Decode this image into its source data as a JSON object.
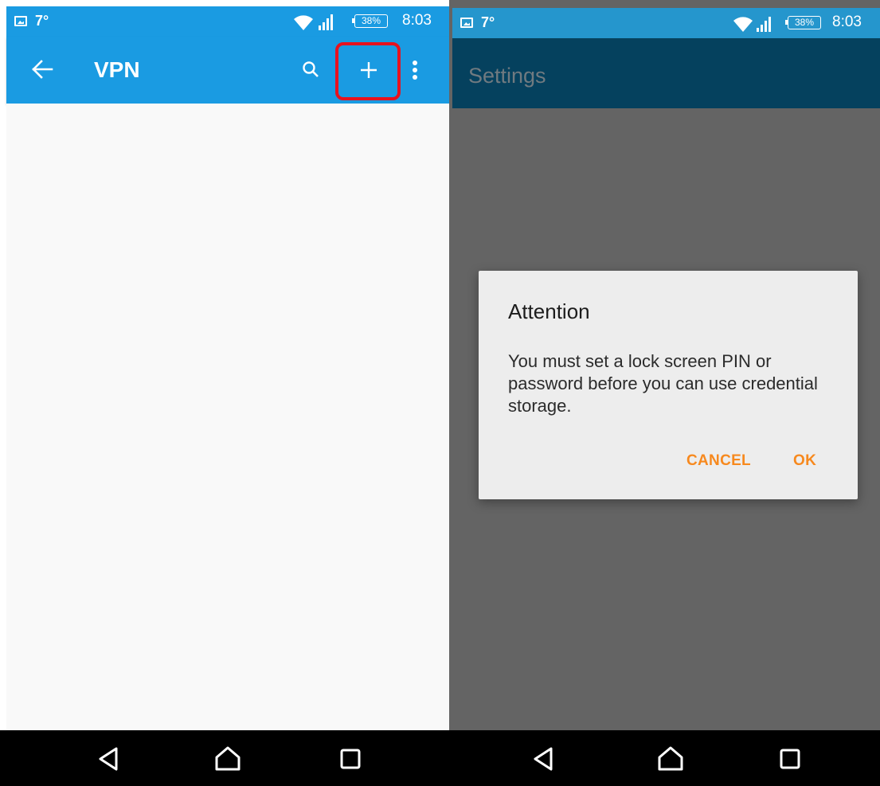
{
  "left": {
    "status": {
      "temperature": "7°",
      "battery": "38%",
      "time": "8:03"
    },
    "appbar": {
      "title": "VPN",
      "icons": [
        "back-arrow-icon",
        "search-icon",
        "plus-icon",
        "overflow-menu-icon"
      ]
    },
    "highlight_color": "#e8121e",
    "colors": {
      "appbar": "#1a9be2"
    }
  },
  "right": {
    "status": {
      "temperature": "7°",
      "battery": "38%",
      "time": "8:03"
    },
    "appbar": {
      "title": "Settings"
    },
    "dialog": {
      "title": "Attention",
      "message": "You must set a lock screen PIN or password before you can use credential storage.",
      "cancel_label": "CANCEL",
      "ok_label": "OK"
    },
    "colors": {
      "appbar": "#05415e",
      "scrim": "#646464",
      "dialog_button": "#f7891e"
    }
  },
  "navbar": {
    "icons": [
      "back-triangle-icon",
      "home-icon",
      "recents-icon"
    ]
  }
}
